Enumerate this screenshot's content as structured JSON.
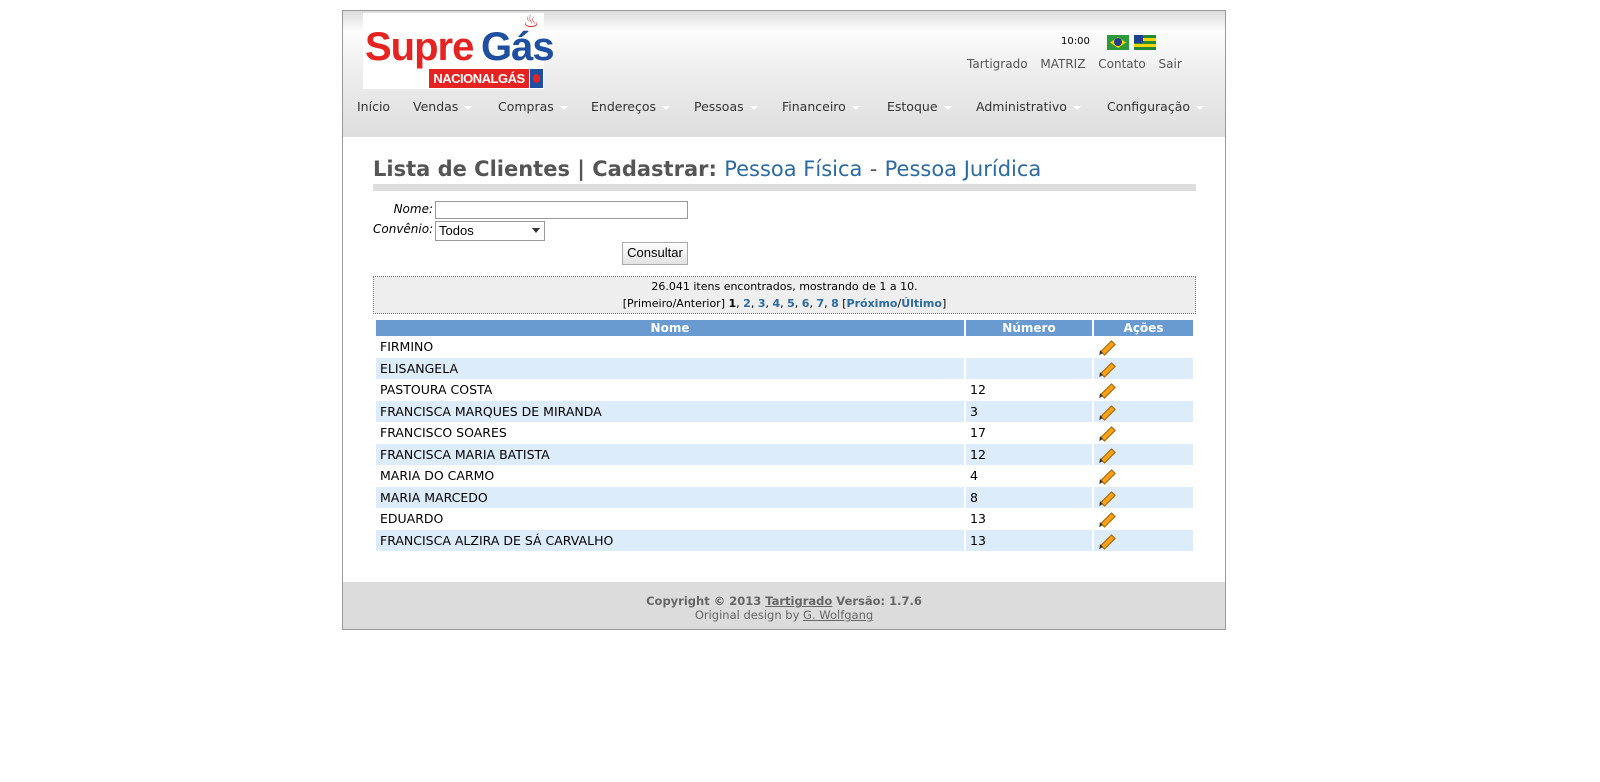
{
  "header": {
    "logo": {
      "text_supre": "Supre",
      "text_gas": "Gás",
      "text_sub": "NACIONALGÁS"
    },
    "clock": "10:00",
    "flags": [
      "brazil-flag-icon",
      "piaui-flag-icon"
    ],
    "top_links": [
      "Tartigrado",
      "MATRIZ",
      "Contato",
      "Sair"
    ]
  },
  "menu": [
    "Início",
    "Vendas",
    "Compras",
    "Endereços",
    "Pessoas",
    "Financeiro",
    "Estoque",
    "Administrativo",
    "Configuração"
  ],
  "page": {
    "title_prefix": "Lista de Clientes | Cadastrar:",
    "link_pf": "Pessoa Física",
    "dash": "-",
    "link_pj": "Pessoa Jurídica"
  },
  "filters": {
    "nome_label": "Nome:",
    "nome_value": "",
    "convenio_label": "Convênio:",
    "convenio_selected": "Todos",
    "submit_label": "Consultar"
  },
  "pagination": {
    "summary": "26.041 itens encontrados, mostrando de 1 a 10.",
    "first_prev": "[Primeiro/Anterior]",
    "current": "1",
    "pages": [
      "2",
      "3",
      "4",
      "5",
      "6",
      "7",
      "8"
    ],
    "next": "Próximo",
    "last": "Último"
  },
  "table": {
    "headers": [
      "Nome",
      "Número",
      "Ações"
    ],
    "rows": [
      {
        "nome": "FIRMINO",
        "numero": ""
      },
      {
        "nome": "ELISANGELA",
        "numero": ""
      },
      {
        "nome": "PASTOURA COSTA",
        "numero": "12"
      },
      {
        "nome": "FRANCISCA MARQUES DE MIRANDA",
        "numero": "3"
      },
      {
        "nome": "FRANCISCO SOARES",
        "numero": "17"
      },
      {
        "nome": "FRANCISCA MARIA BATISTA",
        "numero": "12"
      },
      {
        "nome": "MARIA DO CARMO",
        "numero": "4"
      },
      {
        "nome": "MARIA MARCEDO",
        "numero": "8"
      },
      {
        "nome": "EDUARDO",
        "numero": "13"
      },
      {
        "nome": "FRANCISCA ALZIRA DE SÁ CARVALHO",
        "numero": "13"
      }
    ],
    "action_icon": "edit-pencil-icon"
  },
  "footer": {
    "copyright": "Copyright © 2013",
    "company": "Tartigrado",
    "version": "Versão: 1.7.6",
    "design_prefix": "Original design by",
    "designer": "G. Wolfgang"
  },
  "colors": {
    "header_blue": "#6a9bd0",
    "row_alt": "#ddecfb",
    "link": "#2c6aa0",
    "logo_red": "#e52421",
    "logo_blue": "#1f4fa0"
  }
}
